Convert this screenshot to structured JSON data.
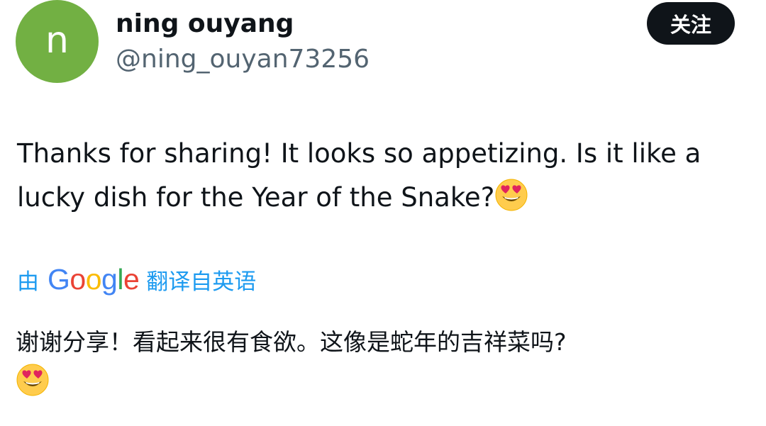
{
  "user": {
    "avatar_letter": "n",
    "display_name": "ning ouyang",
    "handle": "@ning_ouyan73256"
  },
  "follow_button": {
    "label": "关注"
  },
  "tweet": {
    "text": "Thanks for sharing! It looks so appetizing. Is it like a lucky dish for the Year of the Snake?",
    "emoji": "heart-eyes-emoji"
  },
  "translation": {
    "prefix": "由",
    "brand": "Google",
    "suffix": "翻译自英语",
    "text": "谢谢分享！看起来很有食欲。这像是蛇年的吉祥菜吗?",
    "emoji": "heart-eyes-emoji"
  },
  "colors": {
    "avatar_bg": "#72b043",
    "text": "#0f1419",
    "handle": "#536471",
    "link": "#1d9bf0",
    "button_bg": "#0f1419",
    "google_blue": "#4285f4",
    "google_red": "#ea4335",
    "google_yellow": "#fbbc05",
    "google_green": "#34a853"
  }
}
